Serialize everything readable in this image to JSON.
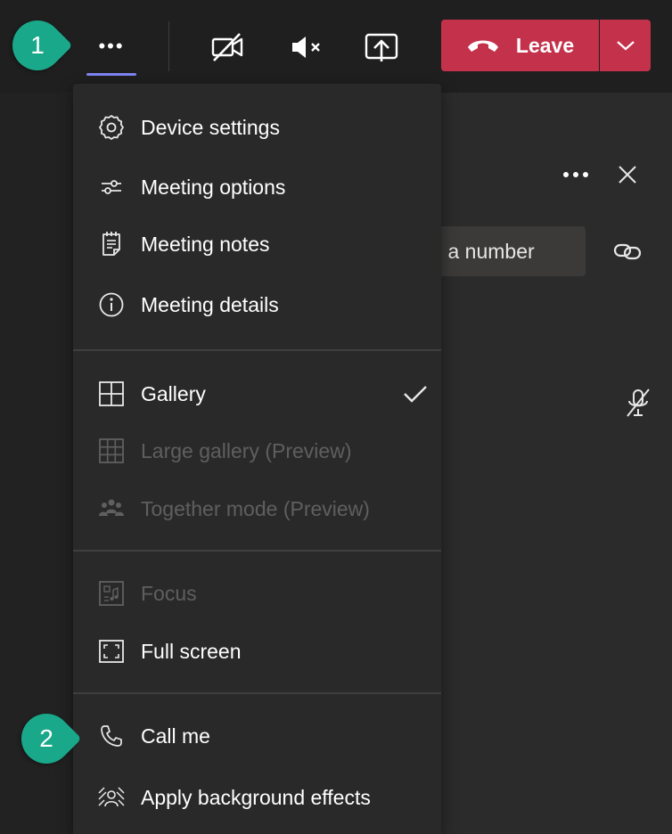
{
  "toolbar": {
    "more_label": "•••",
    "leave_label": "Leave"
  },
  "callouts": {
    "first": "1",
    "second": "2"
  },
  "side_panel": {
    "dial_text": "l a number"
  },
  "menu": {
    "items": [
      {
        "label": "Device settings",
        "icon": "gear-icon",
        "enabled": true
      },
      {
        "label": "Meeting options",
        "icon": "sliders-icon",
        "enabled": true
      },
      {
        "label": "Meeting notes",
        "icon": "notes-icon",
        "enabled": true
      },
      {
        "label": "Meeting details",
        "icon": "info-icon",
        "enabled": true
      },
      {
        "label": "Gallery",
        "icon": "gallery-grid-icon",
        "enabled": true,
        "selected": true
      },
      {
        "label": "Large gallery (Preview)",
        "icon": "large-gallery-icon",
        "enabled": false
      },
      {
        "label": "Together mode (Preview)",
        "icon": "people-group-icon",
        "enabled": false
      },
      {
        "label": "Focus",
        "icon": "focus-icon",
        "enabled": false
      },
      {
        "label": "Full screen",
        "icon": "fullscreen-icon",
        "enabled": true
      },
      {
        "label": "Call me",
        "icon": "phone-icon",
        "enabled": true
      },
      {
        "label": "Apply background effects",
        "icon": "background-effects-icon",
        "enabled": true
      }
    ]
  },
  "colors": {
    "leave_red": "#c4314b",
    "accent": "#7f85f5",
    "callout_teal": "#1aa88a",
    "menu_bg": "#292929"
  }
}
